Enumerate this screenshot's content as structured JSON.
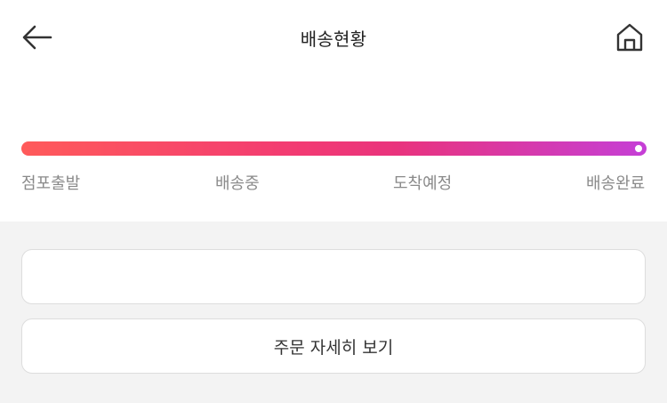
{
  "header": {
    "title": "배송현황",
    "back_icon": "arrow-left-icon",
    "home_icon": "home-icon"
  },
  "progress": {
    "value": 1.0,
    "steps": [
      "점포출발",
      "배송중",
      "도착예정",
      "배송완료"
    ],
    "gradient_colors": [
      "#ff5a5a",
      "#f23a73",
      "#c53fd6"
    ]
  },
  "actions": {
    "detail_label": "주문 자세히 보기"
  }
}
